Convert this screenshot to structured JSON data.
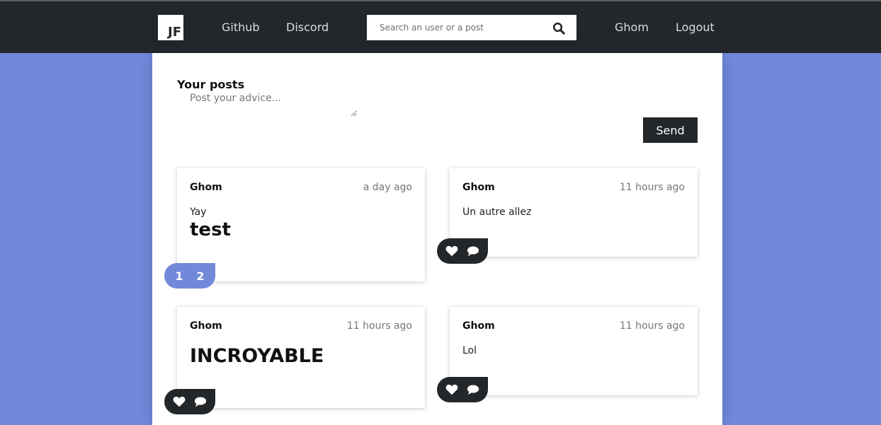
{
  "navbar": {
    "logo_text": "JF",
    "links": [
      {
        "label": "Github"
      },
      {
        "label": "Discord"
      }
    ],
    "search": {
      "placeholder": "Search an user or a post",
      "value": ""
    },
    "user_label": "Ghom",
    "logout_label": "Logout"
  },
  "composer": {
    "title": "Your posts",
    "placeholder": "Post your advice...",
    "send_label": "Send"
  },
  "posts": [
    {
      "author": "Ghom",
      "time": "a day ago",
      "text": "Yay",
      "big": "test",
      "likes": "1",
      "comments": "2"
    },
    {
      "author": "Ghom",
      "time": "11 hours ago",
      "text": "Un autre allez",
      "big": ""
    },
    {
      "author": "Ghom",
      "time": "11 hours ago",
      "text": "",
      "big": "INCROYABLE"
    },
    {
      "author": "Ghom",
      "time": "11 hours ago",
      "text": "Lol",
      "big": ""
    }
  ],
  "colors": {
    "background": "#7289da",
    "navbar": "#23272a",
    "accent": "#7289da",
    "card": "#ffffff"
  },
  "icons": [
    "search-icon",
    "heart-icon",
    "comment-icon"
  ]
}
